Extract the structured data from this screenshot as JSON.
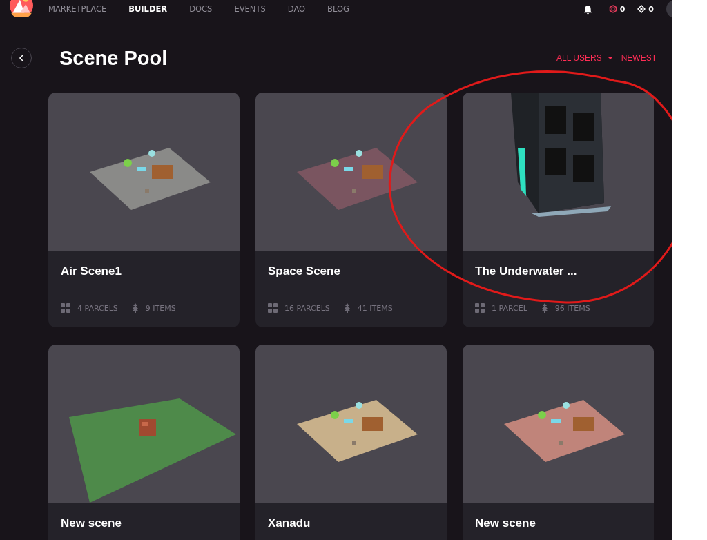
{
  "nav": {
    "items": [
      {
        "label": "MARKETPLACE",
        "selected": false
      },
      {
        "label": "BUILDER",
        "selected": true
      },
      {
        "label": "DOCS",
        "selected": false
      },
      {
        "label": "EVENTS",
        "selected": false
      },
      {
        "label": "DAO",
        "selected": false
      },
      {
        "label": "BLOG",
        "selected": false
      }
    ],
    "mana_count": "0",
    "land_count": "0"
  },
  "page": {
    "title": "Scene Pool",
    "filters": [
      {
        "label": "ALL USERS",
        "kind": "dropdown"
      },
      {
        "label": "NEWEST",
        "kind": "sort"
      }
    ]
  },
  "scenes": [
    {
      "name": "Air Scene1",
      "parcels": "4 PARCELS",
      "items": "9 ITEMS"
    },
    {
      "name": "Space Scene",
      "parcels": "16 PARCELS",
      "items": "41 ITEMS"
    },
    {
      "name": "The Underwater ...",
      "parcels": "1 PARCEL",
      "items": "96 ITEMS"
    },
    {
      "name": "New scene"
    },
    {
      "name": "Xanadu"
    },
    {
      "name": "New scene"
    }
  ]
}
